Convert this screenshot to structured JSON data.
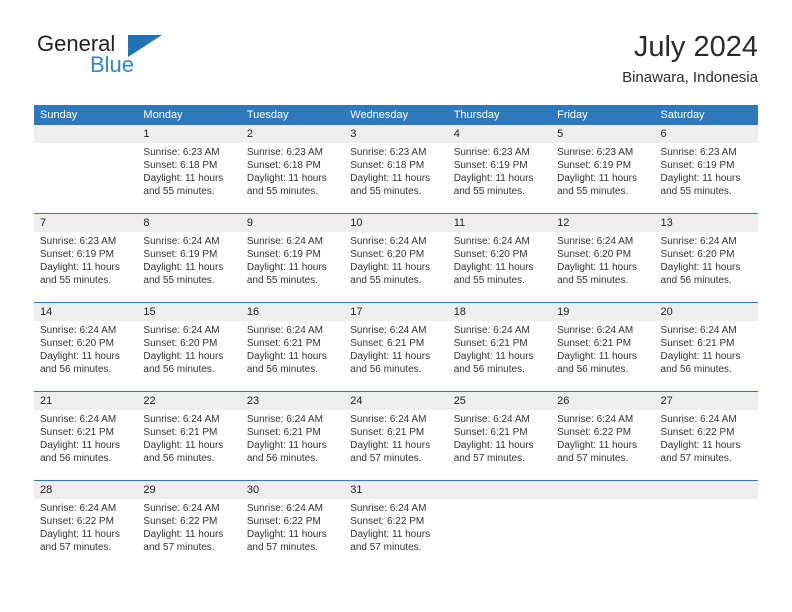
{
  "brand": {
    "name_part1": "General",
    "name_part2": "Blue",
    "accent_color": "#2e86d4",
    "triangle_color": "#2272b8"
  },
  "header": {
    "title": "July 2024",
    "subtitle": "Binawara, Indonesia"
  },
  "theme": {
    "header_bar_color": "#2e79bd",
    "daynum_band_color": "#eeeeee",
    "cell_background": "#ffffff",
    "week_divider_color": "#2e79bd",
    "text_color": "#333333"
  },
  "weekdays": [
    "Sunday",
    "Monday",
    "Tuesday",
    "Wednesday",
    "Thursday",
    "Friday",
    "Saturday"
  ],
  "weeks": [
    {
      "daynums": [
        "",
        "1",
        "2",
        "3",
        "4",
        "5",
        "6"
      ],
      "cells": [
        {
          "sunrise": "",
          "sunset": "",
          "daylight1": "",
          "daylight2": ""
        },
        {
          "sunrise": "Sunrise: 6:23 AM",
          "sunset": "Sunset: 6:18 PM",
          "daylight1": "Daylight: 11 hours",
          "daylight2": "and 55 minutes."
        },
        {
          "sunrise": "Sunrise: 6:23 AM",
          "sunset": "Sunset: 6:18 PM",
          "daylight1": "Daylight: 11 hours",
          "daylight2": "and 55 minutes."
        },
        {
          "sunrise": "Sunrise: 6:23 AM",
          "sunset": "Sunset: 6:18 PM",
          "daylight1": "Daylight: 11 hours",
          "daylight2": "and 55 minutes."
        },
        {
          "sunrise": "Sunrise: 6:23 AM",
          "sunset": "Sunset: 6:19 PM",
          "daylight1": "Daylight: 11 hours",
          "daylight2": "and 55 minutes."
        },
        {
          "sunrise": "Sunrise: 6:23 AM",
          "sunset": "Sunset: 6:19 PM",
          "daylight1": "Daylight: 11 hours",
          "daylight2": "and 55 minutes."
        },
        {
          "sunrise": "Sunrise: 6:23 AM",
          "sunset": "Sunset: 6:19 PM",
          "daylight1": "Daylight: 11 hours",
          "daylight2": "and 55 minutes."
        }
      ]
    },
    {
      "daynums": [
        "7",
        "8",
        "9",
        "10",
        "11",
        "12",
        "13"
      ],
      "cells": [
        {
          "sunrise": "Sunrise: 6:23 AM",
          "sunset": "Sunset: 6:19 PM",
          "daylight1": "Daylight: 11 hours",
          "daylight2": "and 55 minutes."
        },
        {
          "sunrise": "Sunrise: 6:24 AM",
          "sunset": "Sunset: 6:19 PM",
          "daylight1": "Daylight: 11 hours",
          "daylight2": "and 55 minutes."
        },
        {
          "sunrise": "Sunrise: 6:24 AM",
          "sunset": "Sunset: 6:19 PM",
          "daylight1": "Daylight: 11 hours",
          "daylight2": "and 55 minutes."
        },
        {
          "sunrise": "Sunrise: 6:24 AM",
          "sunset": "Sunset: 6:20 PM",
          "daylight1": "Daylight: 11 hours",
          "daylight2": "and 55 minutes."
        },
        {
          "sunrise": "Sunrise: 6:24 AM",
          "sunset": "Sunset: 6:20 PM",
          "daylight1": "Daylight: 11 hours",
          "daylight2": "and 55 minutes."
        },
        {
          "sunrise": "Sunrise: 6:24 AM",
          "sunset": "Sunset: 6:20 PM",
          "daylight1": "Daylight: 11 hours",
          "daylight2": "and 55 minutes."
        },
        {
          "sunrise": "Sunrise: 6:24 AM",
          "sunset": "Sunset: 6:20 PM",
          "daylight1": "Daylight: 11 hours",
          "daylight2": "and 56 minutes."
        }
      ]
    },
    {
      "daynums": [
        "14",
        "15",
        "16",
        "17",
        "18",
        "19",
        "20"
      ],
      "cells": [
        {
          "sunrise": "Sunrise: 6:24 AM",
          "sunset": "Sunset: 6:20 PM",
          "daylight1": "Daylight: 11 hours",
          "daylight2": "and 56 minutes."
        },
        {
          "sunrise": "Sunrise: 6:24 AM",
          "sunset": "Sunset: 6:20 PM",
          "daylight1": "Daylight: 11 hours",
          "daylight2": "and 56 minutes."
        },
        {
          "sunrise": "Sunrise: 6:24 AM",
          "sunset": "Sunset: 6:21 PM",
          "daylight1": "Daylight: 11 hours",
          "daylight2": "and 56 minutes."
        },
        {
          "sunrise": "Sunrise: 6:24 AM",
          "sunset": "Sunset: 6:21 PM",
          "daylight1": "Daylight: 11 hours",
          "daylight2": "and 56 minutes."
        },
        {
          "sunrise": "Sunrise: 6:24 AM",
          "sunset": "Sunset: 6:21 PM",
          "daylight1": "Daylight: 11 hours",
          "daylight2": "and 56 minutes."
        },
        {
          "sunrise": "Sunrise: 6:24 AM",
          "sunset": "Sunset: 6:21 PM",
          "daylight1": "Daylight: 11 hours",
          "daylight2": "and 56 minutes."
        },
        {
          "sunrise": "Sunrise: 6:24 AM",
          "sunset": "Sunset: 6:21 PM",
          "daylight1": "Daylight: 11 hours",
          "daylight2": "and 56 minutes."
        }
      ]
    },
    {
      "daynums": [
        "21",
        "22",
        "23",
        "24",
        "25",
        "26",
        "27"
      ],
      "cells": [
        {
          "sunrise": "Sunrise: 6:24 AM",
          "sunset": "Sunset: 6:21 PM",
          "daylight1": "Daylight: 11 hours",
          "daylight2": "and 56 minutes."
        },
        {
          "sunrise": "Sunrise: 6:24 AM",
          "sunset": "Sunset: 6:21 PM",
          "daylight1": "Daylight: 11 hours",
          "daylight2": "and 56 minutes."
        },
        {
          "sunrise": "Sunrise: 6:24 AM",
          "sunset": "Sunset: 6:21 PM",
          "daylight1": "Daylight: 11 hours",
          "daylight2": "and 56 minutes."
        },
        {
          "sunrise": "Sunrise: 6:24 AM",
          "sunset": "Sunset: 6:21 PM",
          "daylight1": "Daylight: 11 hours",
          "daylight2": "and 57 minutes."
        },
        {
          "sunrise": "Sunrise: 6:24 AM",
          "sunset": "Sunset: 6:21 PM",
          "daylight1": "Daylight: 11 hours",
          "daylight2": "and 57 minutes."
        },
        {
          "sunrise": "Sunrise: 6:24 AM",
          "sunset": "Sunset: 6:22 PM",
          "daylight1": "Daylight: 11 hours",
          "daylight2": "and 57 minutes."
        },
        {
          "sunrise": "Sunrise: 6:24 AM",
          "sunset": "Sunset: 6:22 PM",
          "daylight1": "Daylight: 11 hours",
          "daylight2": "and 57 minutes."
        }
      ]
    },
    {
      "daynums": [
        "28",
        "29",
        "30",
        "31",
        "",
        "",
        ""
      ],
      "cells": [
        {
          "sunrise": "Sunrise: 6:24 AM",
          "sunset": "Sunset: 6:22 PM",
          "daylight1": "Daylight: 11 hours",
          "daylight2": "and 57 minutes."
        },
        {
          "sunrise": "Sunrise: 6:24 AM",
          "sunset": "Sunset: 6:22 PM",
          "daylight1": "Daylight: 11 hours",
          "daylight2": "and 57 minutes."
        },
        {
          "sunrise": "Sunrise: 6:24 AM",
          "sunset": "Sunset: 6:22 PM",
          "daylight1": "Daylight: 11 hours",
          "daylight2": "and 57 minutes."
        },
        {
          "sunrise": "Sunrise: 6:24 AM",
          "sunset": "Sunset: 6:22 PM",
          "daylight1": "Daylight: 11 hours",
          "daylight2": "and 57 minutes."
        },
        {
          "sunrise": "",
          "sunset": "",
          "daylight1": "",
          "daylight2": ""
        },
        {
          "sunrise": "",
          "sunset": "",
          "daylight1": "",
          "daylight2": ""
        },
        {
          "sunrise": "",
          "sunset": "",
          "daylight1": "",
          "daylight2": ""
        }
      ]
    }
  ]
}
